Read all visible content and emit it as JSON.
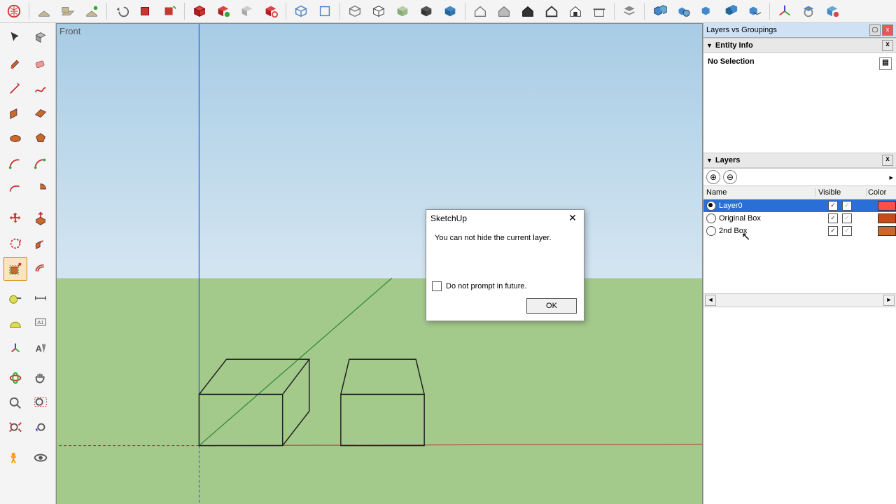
{
  "viewport": {
    "label": "Front"
  },
  "rightPanel": {
    "title": "Layers vs Groupings",
    "entityInfo": {
      "header": "Entity Info",
      "status": "No Selection"
    },
    "layers": {
      "header": "Layers",
      "columns": {
        "name": "Name",
        "visible": "Visible",
        "color": "Color"
      },
      "rows": [
        {
          "name": "Layer0",
          "active": true,
          "vis1": true,
          "vis2": true,
          "color": "#ff4d4d",
          "selected": true
        },
        {
          "name": "Original Box",
          "active": false,
          "vis1": true,
          "vis2": true,
          "color": "#c74a1b",
          "selected": false
        },
        {
          "name": "2nd Box",
          "active": false,
          "vis1": true,
          "vis2": true,
          "color": "#c96a2a",
          "selected": false
        }
      ]
    }
  },
  "dialog": {
    "title": "SketchUp",
    "message": "You can not hide the current layer.",
    "checkbox": "Do not prompt in future.",
    "ok": "OK"
  }
}
